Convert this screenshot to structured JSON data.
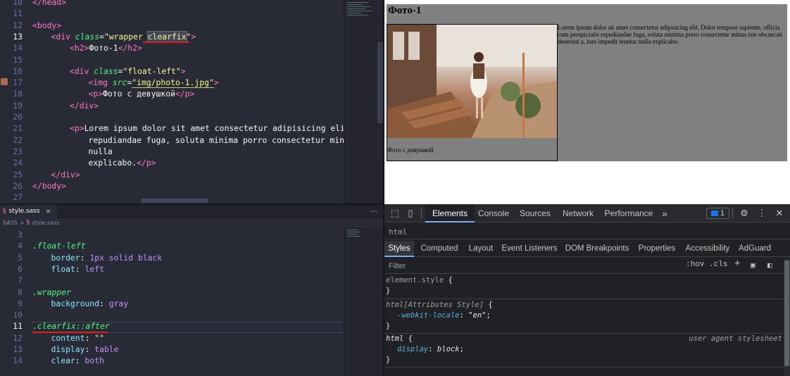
{
  "html_editor": {
    "lines": [
      {
        "no": "10",
        "tokens": [
          {
            "t": "</head>",
            "c": "tk-tag"
          }
        ],
        "indent": 0
      },
      {
        "no": "11",
        "tokens": [],
        "indent": 0
      },
      {
        "no": "12",
        "tokens": [
          {
            "t": "<body>",
            "c": "tk-tag"
          }
        ],
        "indent": 0
      },
      {
        "no": "13",
        "tokens": [
          {
            "t": "<div ",
            "c": "tk-tag"
          },
          {
            "t": "class",
            "c": "tk-attr"
          },
          {
            "t": "=",
            "c": "tk-txt"
          },
          {
            "t": "\"wrapper ",
            "c": "tk-str"
          },
          {
            "t": "clearfix",
            "c": "tk-str hl-word"
          },
          {
            "t": "\"",
            "c": "tk-str"
          },
          {
            "t": ">",
            "c": "tk-tag"
          }
        ],
        "indent": 1,
        "active": true
      },
      {
        "no": "14",
        "tokens": [
          {
            "t": "<h2>",
            "c": "tk-tag"
          },
          {
            "t": "Фото-1",
            "c": "tk-txt"
          },
          {
            "t": "</h2>",
            "c": "tk-tag"
          }
        ],
        "indent": 2
      },
      {
        "no": "15",
        "tokens": [],
        "indent": 0
      },
      {
        "no": "16",
        "tokens": [
          {
            "t": "<div ",
            "c": "tk-tag"
          },
          {
            "t": "class",
            "c": "tk-attr"
          },
          {
            "t": "=",
            "c": "tk-txt"
          },
          {
            "t": "\"float-left\"",
            "c": "tk-str"
          },
          {
            "t": ">",
            "c": "tk-tag"
          }
        ],
        "indent": 2
      },
      {
        "no": "17",
        "tokens": [
          {
            "t": "<img ",
            "c": "tk-tag"
          },
          {
            "t": "src",
            "c": "tk-attr"
          },
          {
            "t": "=",
            "c": "tk-txt"
          },
          {
            "t": "\"img/photo-1.jpg\"",
            "c": "tk-str underline-yellow"
          },
          {
            "t": ">",
            "c": "tk-tag"
          }
        ],
        "indent": 3
      },
      {
        "no": "18",
        "tokens": [
          {
            "t": "<p>",
            "c": "tk-tag"
          },
          {
            "t": "Фото с девушкой",
            "c": "tk-txt"
          },
          {
            "t": "</p>",
            "c": "tk-tag"
          }
        ],
        "indent": 3
      },
      {
        "no": "19",
        "tokens": [
          {
            "t": "</div>",
            "c": "tk-tag"
          }
        ],
        "indent": 2
      },
      {
        "no": "20",
        "tokens": [],
        "indent": 0
      },
      {
        "no": "21",
        "tokens": [
          {
            "t": "<p>",
            "c": "tk-tag"
          },
          {
            "t": "Lorem ipsum dolor sit amet consectetur adipisicing elit.",
            "c": "tk-txt"
          }
        ],
        "indent": 2
      },
      {
        "no": "22",
        "tokens": [
          {
            "t": "repudiandae fuga, soluta minima porro consectetur minus",
            "c": "tk-txt"
          }
        ],
        "indent": 3
      },
      {
        "no": "23",
        "tokens": [
          {
            "t": "nulla",
            "c": "tk-txt"
          }
        ],
        "indent": 3
      },
      {
        "no": "24",
        "tokens": [
          {
            "t": "explicabo.",
            "c": "tk-txt"
          },
          {
            "t": "</p>",
            "c": "tk-tag"
          }
        ],
        "indent": 3
      },
      {
        "no": "25",
        "tokens": [
          {
            "t": "</div>",
            "c": "tk-tag"
          }
        ],
        "indent": 1
      },
      {
        "no": "26",
        "tokens": [
          {
            "t": "</body>",
            "c": "tk-tag"
          }
        ],
        "indent": 0
      },
      {
        "no": "27",
        "tokens": [],
        "indent": 0
      }
    ]
  },
  "sass_editor": {
    "tab_label": "style.sass",
    "tab_icon": "sass-icon",
    "more_label": "···",
    "breadcrumb": [
      "SASS",
      ">",
      "style.sass"
    ],
    "lines": [
      {
        "no": "3",
        "tokens": [],
        "indent": 0
      },
      {
        "no": "4",
        "tokens": [
          {
            "t": ".float-left",
            "c": "tk-sel"
          }
        ],
        "indent": 0
      },
      {
        "no": "5",
        "tokens": [
          {
            "t": "border",
            "c": "tk-prop"
          },
          {
            "t": ": ",
            "c": "tk-txt"
          },
          {
            "t": "1px",
            "c": "tk-num"
          },
          {
            "t": " solid black",
            "c": "tk-kw"
          }
        ],
        "indent": 1
      },
      {
        "no": "6",
        "tokens": [
          {
            "t": "float",
            "c": "tk-prop"
          },
          {
            "t": ": ",
            "c": "tk-txt"
          },
          {
            "t": "left",
            "c": "tk-kw"
          }
        ],
        "indent": 1
      },
      {
        "no": "7",
        "tokens": [],
        "indent": 0
      },
      {
        "no": "8",
        "tokens": [
          {
            "t": ".wrapper",
            "c": "tk-sel"
          }
        ],
        "indent": 0
      },
      {
        "no": "9",
        "tokens": [
          {
            "t": "background",
            "c": "tk-prop"
          },
          {
            "t": ": ",
            "c": "tk-txt"
          },
          {
            "t": "gray",
            "c": "tk-kw"
          }
        ],
        "indent": 1
      },
      {
        "no": "10",
        "tokens": [],
        "indent": 0
      },
      {
        "no": "11",
        "tokens": [
          {
            "t": ".clearfix::after",
            "c": "tk-sel"
          }
        ],
        "indent": 0,
        "active": true
      },
      {
        "no": "12",
        "tokens": [
          {
            "t": "content",
            "c": "tk-prop"
          },
          {
            "t": ": ",
            "c": "tk-txt"
          },
          {
            "t": "\"\"",
            "c": "tk-str"
          }
        ],
        "indent": 1
      },
      {
        "no": "13",
        "tokens": [
          {
            "t": "display",
            "c": "tk-prop"
          },
          {
            "t": ": ",
            "c": "tk-txt"
          },
          {
            "t": "table",
            "c": "tk-kw"
          }
        ],
        "indent": 1
      },
      {
        "no": "14",
        "tokens": [
          {
            "t": "clear",
            "c": "tk-prop"
          },
          {
            "t": ": ",
            "c": "tk-txt"
          },
          {
            "t": "both",
            "c": "tk-kw"
          }
        ],
        "indent": 1
      }
    ]
  },
  "preview": {
    "heading": "Фото-1",
    "caption": "Фото с девушкой",
    "paragraph": "Lorem ipsum dolor sit amet consectetur adipisicing elit. Dolor tempore sapiente, officia cum perspiciatis repudiandae fuga, soluta minima porro consectetur minus iste obcaecati deserunt a, iure impedit tenetur nulla explicabo.",
    "wrapper_color": "#808080"
  },
  "devtools": {
    "tabs": [
      "Elements",
      "Console",
      "Sources",
      "Network",
      "Performance"
    ],
    "active_tab": "Elements",
    "more_tabs": "»",
    "messages_count": "1",
    "crumb": "html",
    "subtabs": [
      "Styles",
      "Computed",
      "Layout",
      "Event Listeners",
      "DOM Breakpoints",
      "Properties",
      "Accessibility",
      "AdGuard"
    ],
    "active_subtab": "Styles",
    "filter_placeholder": "Filter",
    "hov": ":hov",
    "cls": ".cls",
    "plus": "+",
    "rules": {
      "r1_selector": "element.style",
      "r1_open": " {",
      "r1_close": "}",
      "r2_selector": "html[Attributes Style]",
      "r2_open": " {",
      "r2_prop": "-webkit-locale",
      "r2_val": "\"en\"",
      "r2_close": "}",
      "r3_selector": "html",
      "r3_open": " {",
      "r3_source": "user agent stylesheet",
      "r3_prop": "display",
      "r3_val": "block",
      "r3_close": "}"
    }
  }
}
